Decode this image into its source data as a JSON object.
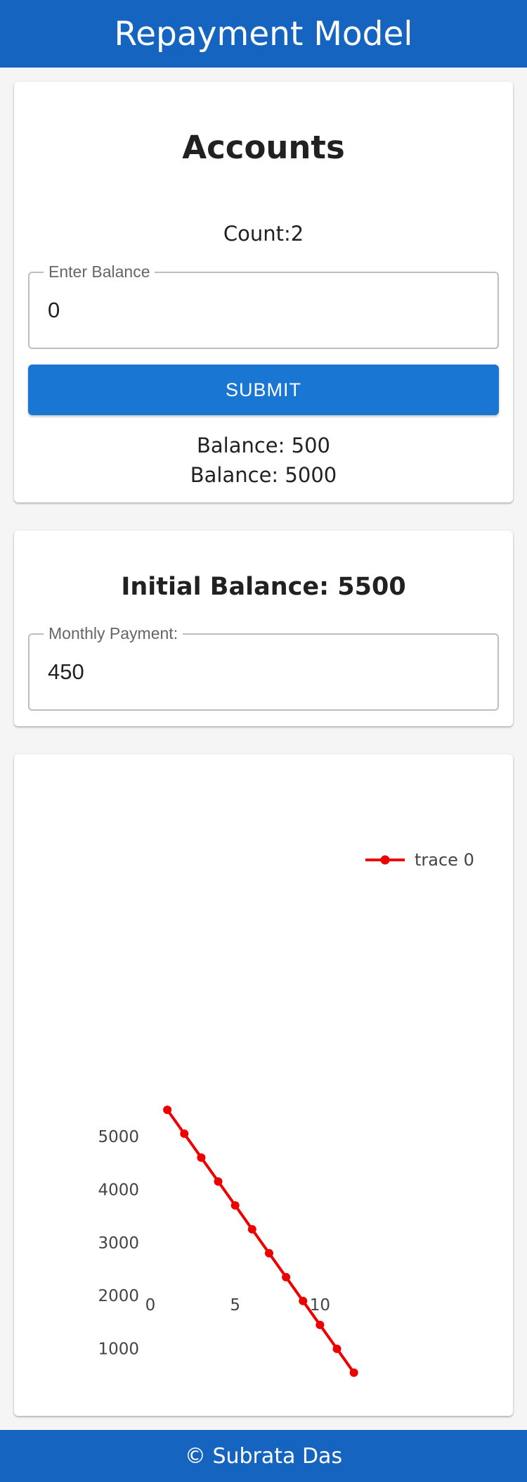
{
  "header": {
    "title": "Repayment Model"
  },
  "accounts": {
    "title": "Accounts",
    "count_text": "Count:2",
    "balance_input": {
      "label": "Enter Balance",
      "value": "0"
    },
    "submit_label": "SUBMIT",
    "balances": [
      "Balance: 500",
      "Balance: 5000"
    ]
  },
  "repayment": {
    "initial_balance_text": "Initial Balance: 5500",
    "monthly_payment_input": {
      "label": "Monthly Payment:",
      "value": "450"
    }
  },
  "chart_data": {
    "type": "line",
    "title": "",
    "xlabel": "",
    "ylabel": "",
    "x": [
      1,
      2,
      3,
      4,
      5,
      6,
      7,
      8,
      9,
      10,
      11,
      12
    ],
    "series": [
      {
        "name": "trace 0",
        "color": "#ee0000",
        "values": [
          5500,
          5050,
          4600,
          4150,
          3700,
          3250,
          2800,
          2350,
          1900,
          1450,
          1000,
          550
        ]
      }
    ],
    "xlim": [
      0,
      14.5
    ],
    "ylim": [
      400,
      5700
    ],
    "x_ticks": [
      0,
      5,
      10
    ],
    "y_ticks": [
      1000,
      2000,
      3000,
      4000,
      5000
    ],
    "grid": false,
    "legend_position": "top-right",
    "markers": true
  },
  "footer": {
    "text": "© Subrata Das"
  }
}
